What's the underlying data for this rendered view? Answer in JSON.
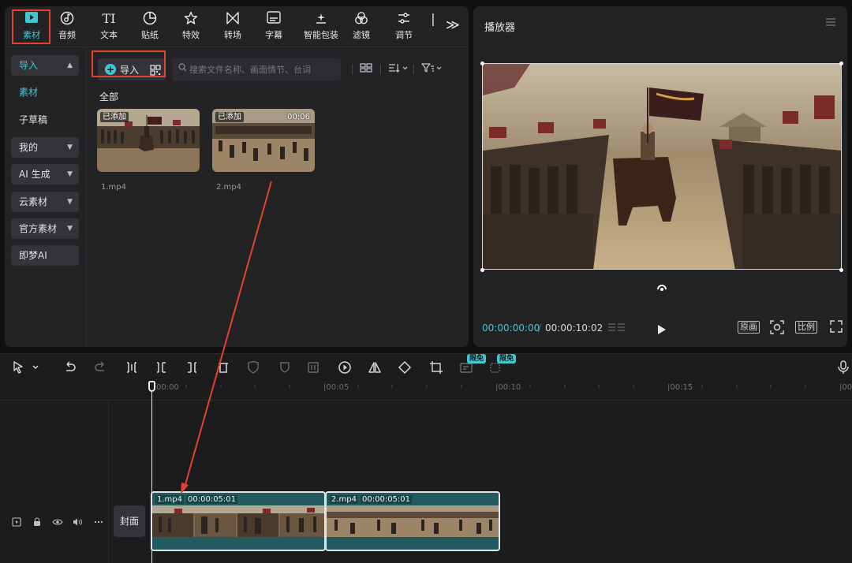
{
  "toolbar": {
    "items": [
      {
        "label": "素材",
        "icon": "media-icon"
      },
      {
        "label": "音频",
        "icon": "audio-icon"
      },
      {
        "label": "文本",
        "icon": "text-icon"
      },
      {
        "label": "贴纸",
        "icon": "sticker-icon"
      },
      {
        "label": "特效",
        "icon": "effects-icon"
      },
      {
        "label": "转场",
        "icon": "transition-icon"
      },
      {
        "label": "字幕",
        "icon": "subtitle-icon"
      },
      {
        "label": "智能包装",
        "icon": "smart-pack-icon"
      },
      {
        "label": "滤镜",
        "icon": "filter-icon"
      },
      {
        "label": "调节",
        "icon": "adjust-icon"
      }
    ],
    "more_icon": "≫"
  },
  "sidebar": {
    "items": [
      {
        "label": "导入"
      },
      {
        "label": "素材"
      },
      {
        "label": "子草稿"
      },
      {
        "label": "我的"
      },
      {
        "label": "AI 生成"
      },
      {
        "label": "云素材"
      },
      {
        "label": "官方素材"
      },
      {
        "label": "即梦AI"
      }
    ]
  },
  "media": {
    "import_label": "导入",
    "search_placeholder": "搜索文件名称、画面情节、台词",
    "all_label": "全部",
    "files": [
      {
        "name": "1.mp4",
        "tag": "已添加",
        "duration": ""
      },
      {
        "name": "2.mp4",
        "tag": "已添加",
        "duration": "00:06"
      }
    ]
  },
  "player": {
    "title": "播放器",
    "current_time": "00:00:00:00",
    "separator": "/",
    "total_time": "00:00:10:02",
    "original_label": "原画",
    "ratio_label": "比例"
  },
  "timeline": {
    "ruler": [
      "00:00",
      "|00:05",
      "|00:10",
      "|00:15",
      "|00"
    ],
    "badge": "限免",
    "cover_label": "封面",
    "clips": [
      {
        "name": "1.mp4",
        "duration": "00:00:05:01"
      },
      {
        "name": "2.mp4",
        "duration": "00:00:05:01"
      }
    ]
  },
  "colors": {
    "accent": "#41c7d2",
    "annotation": "#e4412f",
    "clip": "#215a5f"
  }
}
